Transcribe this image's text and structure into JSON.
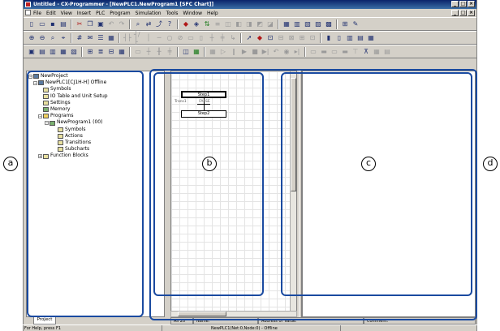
{
  "window": {
    "title": "Untitled - CX-Programmer - [NewPLC1.NewProgram1 [SFC Chart]]"
  },
  "menu": [
    "File",
    "Edit",
    "View",
    "Insert",
    "PLC",
    "Program",
    "Simulation",
    "Tools",
    "Window",
    "Help"
  ],
  "window_buttons": [
    "_",
    "□",
    "×"
  ],
  "tree": {
    "root": "NewProject",
    "plc": "NewPLC1[CJ1H-H] Offline",
    "items": [
      "Symbols",
      "IO Table and Unit Setup",
      "Settings",
      "Memory",
      "Programs"
    ],
    "program": "NewProgram1 (00)",
    "program_children": [
      "Symbols",
      "Actions",
      "Transitions",
      "Subcharts"
    ],
    "function_blocks": "Function Blocks"
  },
  "project_tab": "Project",
  "sfc": {
    "step1": "Step1",
    "transition": "Trans1",
    "transition_cond": "FALSE",
    "step2": "Step2"
  },
  "address_bar": {
    "prefix": "All 20",
    "name": "Name:",
    "address": "Address or Value:",
    "comment": "Comment:"
  },
  "status": {
    "help": "For Help, press F1",
    "mode": "NewPLC1(Net:0,Node:0) - Offline"
  },
  "callouts": {
    "a": "a",
    "b": "b",
    "c": "c",
    "d": "d"
  },
  "colors": {
    "callout_border": "#1a4aa0",
    "titlebar": "#0a246a"
  }
}
